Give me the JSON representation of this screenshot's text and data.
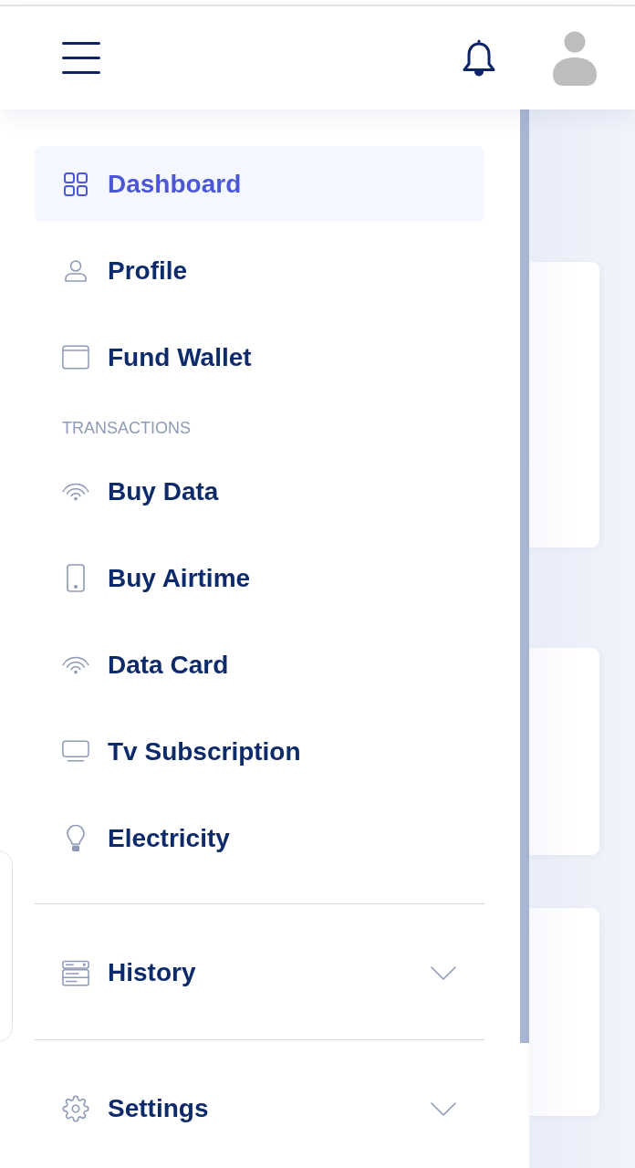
{
  "sidebar": {
    "items": [
      {
        "kind": "link",
        "label": "Dashboard",
        "selected": true
      },
      {
        "kind": "link",
        "label": "Profile",
        "selected": false
      },
      {
        "kind": "link",
        "label": "Fund Wallet",
        "selected": false
      },
      {
        "kind": "heading",
        "label": "TRANSACTIONS"
      },
      {
        "kind": "link",
        "label": "Buy Data",
        "selected": false
      },
      {
        "kind": "link",
        "label": "Buy Airtime",
        "selected": false
      },
      {
        "kind": "link",
        "label": "Data Card",
        "selected": false
      },
      {
        "kind": "link",
        "label": "Tv Subscription",
        "selected": false
      },
      {
        "kind": "link",
        "label": "Electricity",
        "selected": false
      },
      {
        "kind": "collapsible",
        "label": "History",
        "selected": false,
        "expanded": false
      },
      {
        "kind": "collapsible",
        "label": "Settings",
        "selected": false,
        "expanded": false
      }
    ]
  }
}
